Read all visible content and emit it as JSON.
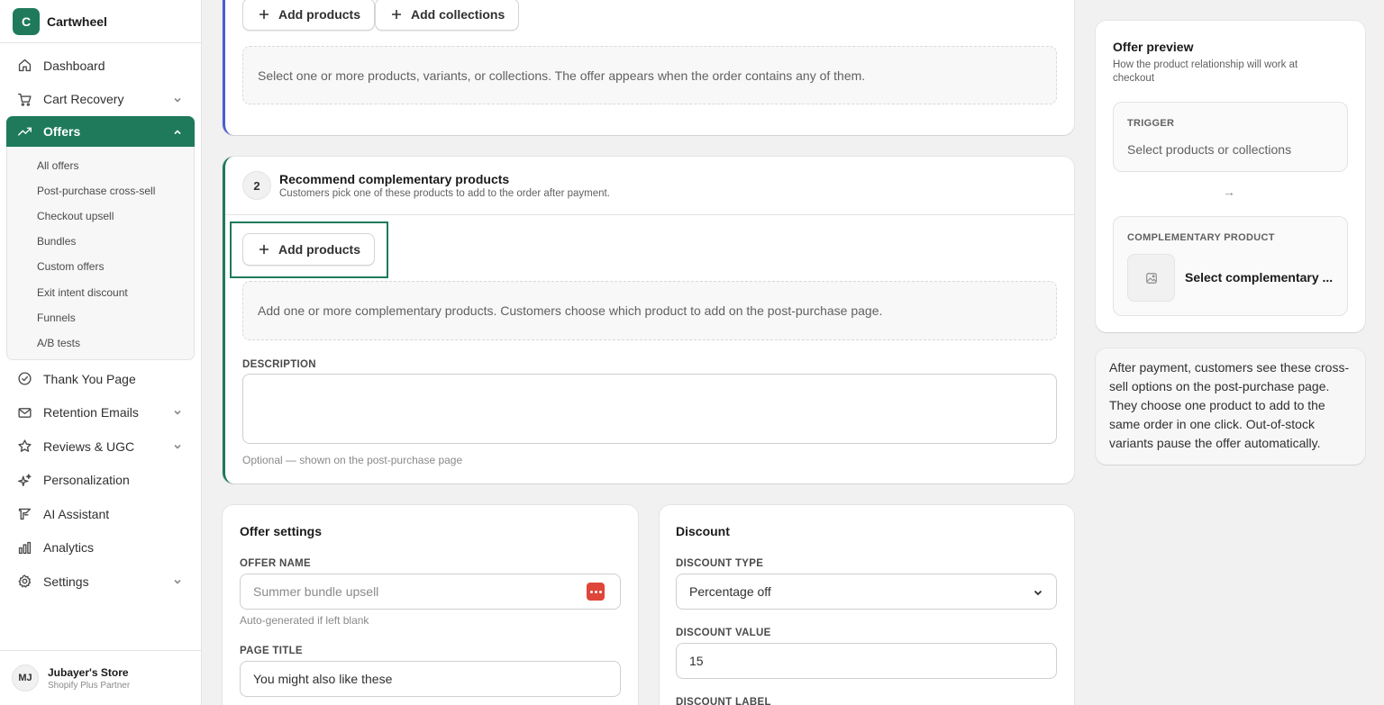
{
  "brand": {
    "initial": "C",
    "name": "Cartwheel"
  },
  "nav": {
    "items": [
      {
        "label": "Dashboard",
        "icon": "home-icon",
        "chevron": false
      },
      {
        "label": "Cart Recovery",
        "icon": "cart-icon",
        "chevron": true
      }
    ],
    "active": {
      "label": "Offers",
      "icon": "trending-icon"
    },
    "sub_items": [
      "All offers",
      "Post-purchase cross-sell",
      "Checkout upsell",
      "Bundles",
      "Custom offers",
      "Exit intent discount",
      "Funnels",
      "A/B tests"
    ],
    "items_after": [
      {
        "label": "Thank You Page",
        "icon": "check-circle-icon",
        "chevron": false
      },
      {
        "label": "Retention Emails",
        "icon": "mail-icon",
        "chevron": true
      },
      {
        "label": "Reviews & UGC",
        "icon": "star-icon",
        "chevron": true
      },
      {
        "label": "Personalization",
        "icon": "sparkle-icon",
        "chevron": false
      },
      {
        "label": "AI Assistant",
        "icon": "ai-icon",
        "chevron": false
      },
      {
        "label": "Analytics",
        "icon": "bar-chart-icon",
        "chevron": false
      },
      {
        "label": "Settings",
        "icon": "gear-icon",
        "chevron": true
      }
    ]
  },
  "footer": {
    "initials": "MJ",
    "store_name": "Jubayer's Store",
    "store_sub": "Shopify Plus Partner"
  },
  "trigger_card": {
    "add_products": "Add products",
    "add_collections": "Add collections",
    "empty_text": "Select one or more products, variants, or collections. The offer appears when the order contains any of them."
  },
  "step2": {
    "number": "2",
    "title": "Recommend complementary products",
    "subtitle": "Customers pick one of these products to add to the order after payment.",
    "add_products": "Add products",
    "empty_text": "Add one or more complementary products. Customers choose which product to add on the post-purchase page.",
    "description_label": "DESCRIPTION",
    "description_value": "",
    "description_help": "Optional — shown on the post-purchase page"
  },
  "offer_settings": {
    "title": "Offer settings",
    "offer_name_label": "OFFER NAME",
    "offer_name_placeholder": "Summer bundle upsell",
    "offer_name_help": "Auto-generated if left blank",
    "page_title_label": "PAGE TITLE",
    "page_title_value": "You might also like these"
  },
  "discount": {
    "title": "Discount",
    "type_label": "DISCOUNT TYPE",
    "type_value": "Percentage off",
    "value_label": "DISCOUNT VALUE",
    "value_value": "15",
    "label_label": "DISCOUNT LABEL"
  },
  "preview": {
    "title": "Offer preview",
    "subtitle": "How the product relationship will work at checkout",
    "trigger_label": "TRIGGER",
    "trigger_value": "Select products or collections",
    "arrow": "→",
    "comp_label": "COMPLEMENTARY PRODUCT",
    "comp_value": "Select complementary ..."
  },
  "info_text": "After payment, customers see these cross-sell options on the post-purchase page. They choose one product to add to the same order in one click. Out-of-stock variants pause the offer automatically.",
  "colors": {
    "brand": "#1f7a5c",
    "trigger_accent": "#4a5fd1",
    "highlight": "#1f7a5c",
    "menu_chip": "#e0453a"
  }
}
